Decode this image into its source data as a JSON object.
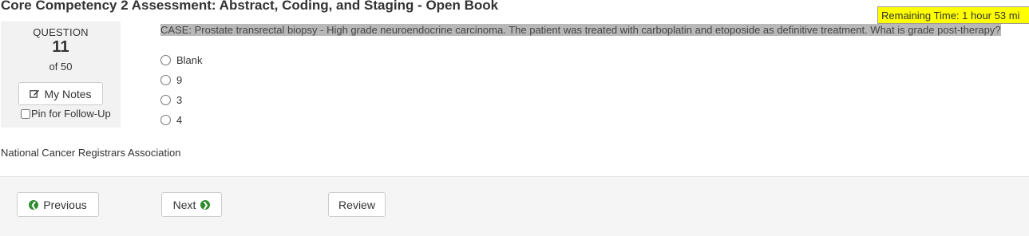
{
  "header": {
    "title": "Core Competency 2 Assessment: Abstract, Coding, and Staging - Open Book",
    "remaining_time": "Remaining Time: 1 hour 53 mi"
  },
  "question_panel": {
    "label": "QUESTION",
    "number": "11",
    "of_total": "of 50",
    "notes_button": "My Notes",
    "pin_label": "Pin for Follow-Up",
    "pin_checked": false
  },
  "question": {
    "text": "CASE: Prostate transrectal biopsy - High grade neuroendocrine carcinoma. The patient was treated with carboplatin and etoposide as definitive treatment. What is grade post-therapy?",
    "options": [
      "Blank",
      "9",
      "3",
      "4"
    ],
    "selected": null
  },
  "footer": {
    "organization": "National Cancer Registrars Association"
  },
  "navigation": {
    "previous": "Previous",
    "next": "Next",
    "review": "Review"
  },
  "colors": {
    "timer_bg": "#ffff00",
    "highlight_bg": "#b8b8b8",
    "icon_green": "#2e8b2e",
    "bottom_bar_bg": "#f5f5f5",
    "panel_bg": "#f2f2f2"
  },
  "icons": {
    "notes": "edit-icon",
    "previous": "chevron-left-circle-icon",
    "next": "chevron-right-circle-icon"
  }
}
